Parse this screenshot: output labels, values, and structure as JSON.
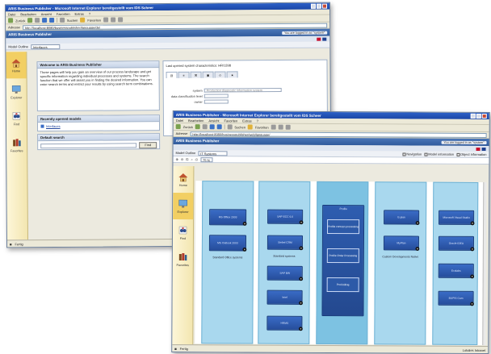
{
  "colors": {
    "accent": "#2b5fc7",
    "lane": "#a9d8ee",
    "object": "#2f5fb3",
    "sidebar_active": "#f2cf63"
  },
  "back_window": {
    "title": "ARIS Business Publisher - Microsoft Internet Explorer bereitgestellt vom IDS Scheer",
    "menu": [
      "Datei",
      "Bearbeiten",
      "Ansicht",
      "Favoriten",
      "Extras",
      "?"
    ],
    "toolbar": {
      "back": "Zurück",
      "search": "Suchen",
      "favorites": "Favoriten"
    },
    "address_label": "Adresse",
    "address_value": "http://localhost:8080/businesspublisher/language/de/",
    "app_title": "ARIS Business Publisher",
    "login": "You are logged in as \"system\"",
    "model_outline_label": "Model Outline",
    "model_outline_value": "Interfaces",
    "nav": [
      {
        "label": "Home",
        "icon": "house-icon"
      },
      {
        "label": "Explorer",
        "icon": "monitor-icon"
      },
      {
        "label": "Find",
        "icon": "binoculars-icon"
      },
      {
        "label": "Favorites",
        "icon": "books-icon"
      }
    ],
    "welcome": {
      "heading": "Welcome to ARIS Business Publisher",
      "body": "These pages will help you gain an overview of our process landscape and get specific information regarding individual processes and systems. The search function that we offer will assist you in finding the desired information. You can enter search terms and restrict your results by using search term combinations."
    },
    "recent": {
      "heading": "Recently opened models",
      "item": "Interfaces"
    },
    "default_search": {
      "heading": "Default search",
      "button": "Find"
    },
    "right": {
      "header": "Last opened system characteristics: HR/1398",
      "fields": [
        {
          "label": "system",
          "value": "Production diagnostic information system"
        },
        {
          "label": "data classification level",
          "value": ""
        },
        {
          "label": "owner",
          "value": ""
        }
      ]
    },
    "status": "Fertig"
  },
  "front_window": {
    "title": "ARIS Business Publisher - Microsoft Internet Explorer bereitgestellt vom IDS Scheer",
    "menu": [
      "Datei",
      "Bearbeiten",
      "Ansicht",
      "Favoriten",
      "Extras",
      "?"
    ],
    "toolbar": {
      "back": "Zurück",
      "search": "Suchen",
      "favorites": "Favoriten"
    },
    "address_label": "Adresse",
    "address_value": "http://localhost:8080/businesspublisher/web/language/",
    "app_title": "ARIS Business Publisher",
    "login": "You are logged in as \"system\"",
    "model_outline_label": "Model Outline",
    "model_outline_value": "IT Systems",
    "zoom": "75 %",
    "checks": [
      "Navigation",
      "Model information",
      "Object information"
    ],
    "nav": [
      {
        "label": "Home",
        "icon": "house-icon"
      },
      {
        "label": "Explorer",
        "icon": "monitor-icon"
      },
      {
        "label": "Find",
        "icon": "binoculars-icon"
      },
      {
        "label": "Favorites",
        "icon": "books-icon"
      }
    ],
    "lanes": [
      {
        "label": "Standard Office systems",
        "objects": [
          "MS Office 2003",
          "MS Outlook 2003"
        ]
      },
      {
        "label": "Standard systems",
        "objects": [
          "SAP ECC 6.0",
          "Siebel CRM",
          "SAP BW",
          "Intel",
          "HRMS"
        ]
      },
      {
        "label": "Profile",
        "objects": [
          "Profile",
          "Profile contract processing",
          "Profile Order Processing",
          "Profi billing"
        ]
      },
      {
        "label": "Custom Developments Native",
        "objects": [
          "E-plan",
          "MyPlan"
        ]
      },
      {
        "label": "",
        "objects": [
          "Microsoft Visual Studio",
          "Oracle IDEA",
          "Ecolabs",
          "BUPIS Cam"
        ]
      }
    ],
    "status_left": "Fertig",
    "status_right": "Lokales Intranet"
  }
}
